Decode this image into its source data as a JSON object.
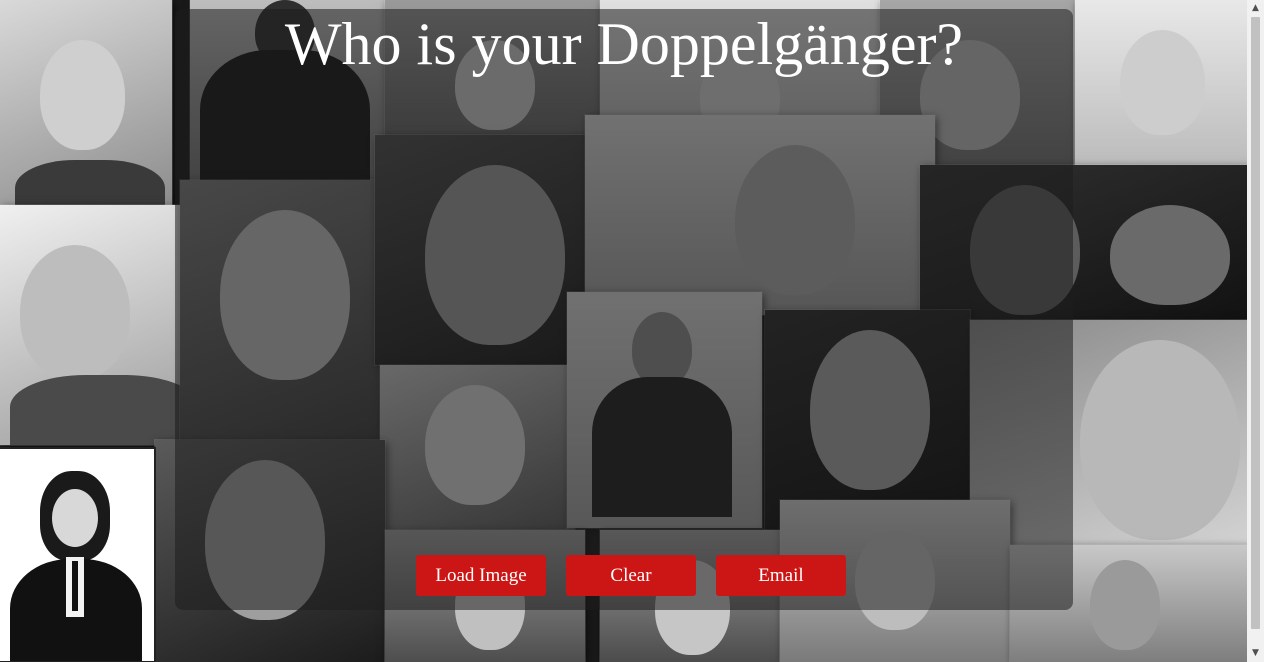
{
  "page": {
    "title": "Who is your Doppelgänger?"
  },
  "buttons": {
    "load_label": "Load Image",
    "clear_label": "Clear",
    "email_label": "Email"
  },
  "colors": {
    "button_bg": "#cc1515",
    "overlay": "rgba(30,30,30,0.55)",
    "title_text": "#ffffff"
  },
  "icons": {
    "scroll_up": "scroll-up-arrow-icon",
    "scroll_down": "scroll-down-arrow-icon"
  }
}
